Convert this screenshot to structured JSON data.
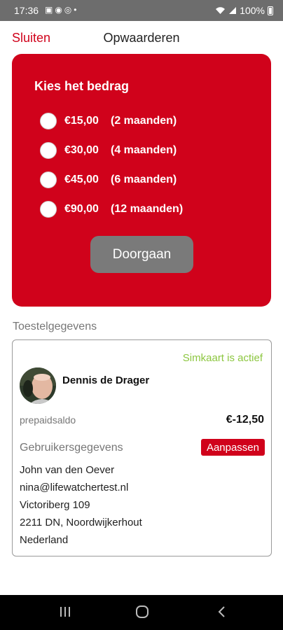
{
  "status_bar": {
    "time": "17:36",
    "battery": "100%",
    "icons": [
      "notification-icons",
      "wifi-icon",
      "signal-icon",
      "battery-icon"
    ]
  },
  "header": {
    "close_label": "Sluiten",
    "title": "Opwaarderen"
  },
  "amount_card": {
    "title": "Kies het bedrag",
    "options": [
      {
        "price": "€15,00",
        "period": "(2 maanden)"
      },
      {
        "price": "€30,00",
        "period": "(4 maanden)"
      },
      {
        "price": "€45,00",
        "period": "(6 maanden)"
      },
      {
        "price": "€90,00",
        "period": "(12 maanden)"
      }
    ],
    "continue_label": "Doorgaan"
  },
  "device": {
    "section_label": "Toestelgegevens",
    "sim_status": "Simkaart is actief",
    "user_name": "Dennis de Drager",
    "prepaid_label": "prepaidsaldo",
    "prepaid_value": "€-12,50",
    "user_data_label": "Gebruikersgegevens",
    "edit_label": "Aanpassen",
    "address_lines": [
      "John van den Oever",
      "nina@lifewatchertest.nl",
      "Victoriberg 109",
      "2211 DN, Noordwijkerhout",
      "Nederland"
    ]
  },
  "colors": {
    "brand_red": "#d0021b",
    "active_green": "#8cc63f",
    "button_gray": "#7a7a7a"
  }
}
